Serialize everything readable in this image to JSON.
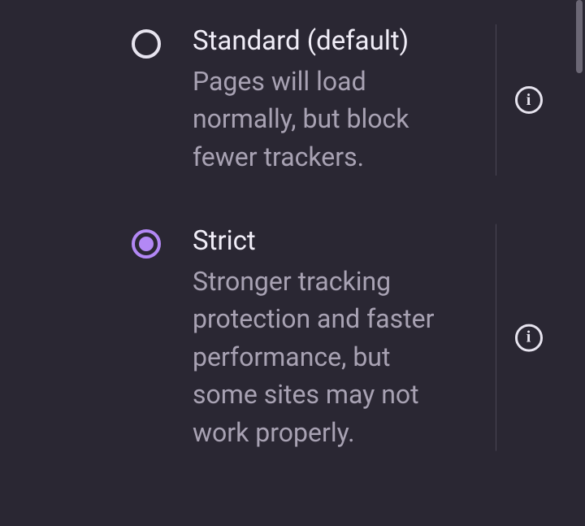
{
  "options": [
    {
      "title": "Standard (default)",
      "description": "Pages will load normally, but block fewer trackers.",
      "selected": false
    },
    {
      "title": "Strict",
      "description": "Stronger tracking protection and faster performance, but some sites may not work properly.",
      "selected": true
    }
  ],
  "info_glyph": "i"
}
